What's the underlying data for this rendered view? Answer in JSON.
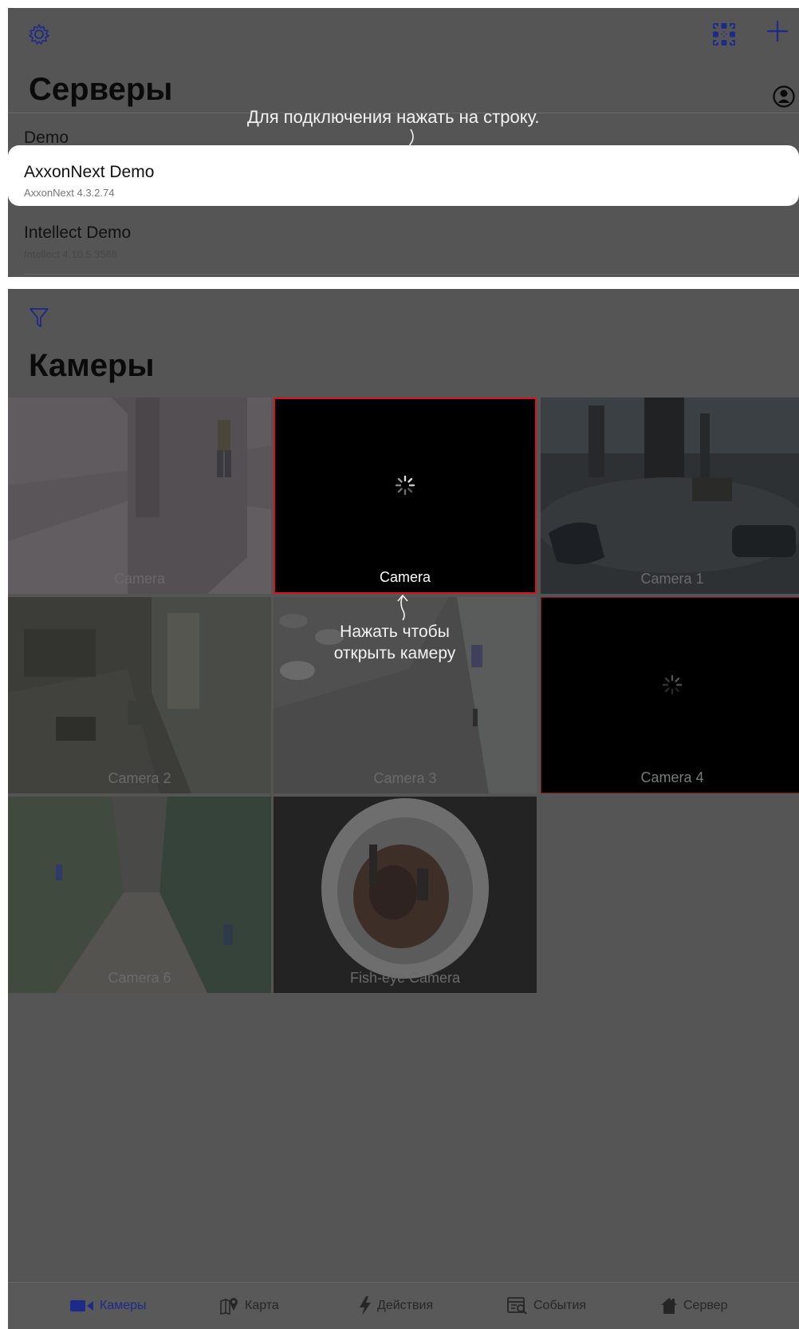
{
  "servers": {
    "title": "Серверы",
    "group_label": "Demo",
    "hint": "Для подключения нажать на строку.",
    "rows": [
      {
        "name": "AxxonNext Demo",
        "version": "AxxonNext 4.3.2.74",
        "highlighted": true
      },
      {
        "name": "Intellect Demo",
        "version": "Intellect 4.10.5.3588",
        "highlighted": false
      }
    ],
    "icons": {
      "settings": "gear-icon",
      "dialpad": "dialpad-icon",
      "add": "plus-icon",
      "account": "account-icon"
    }
  },
  "cameras": {
    "title": "Камеры",
    "hint_line1": "Нажать чтобы",
    "hint_line2": "открыть камеру",
    "tiles": [
      {
        "label": "Camera",
        "state": "video"
      },
      {
        "label": "Camera",
        "state": "loading"
      },
      {
        "label": "Camera 1",
        "state": "video"
      },
      {
        "label": "Camera 2",
        "state": "video"
      },
      {
        "label": "Camera 3",
        "state": "video"
      },
      {
        "label": "Camera 4",
        "state": "loading"
      },
      {
        "label": "Camera 6",
        "state": "video"
      },
      {
        "label": "Fish-eye Camera",
        "state": "video"
      }
    ],
    "icons": {
      "filter": "filter-icon",
      "loading": "spinner-icon"
    }
  },
  "tabbar": {
    "tabs": [
      {
        "label": "Камеры",
        "icon": "video-camera-icon",
        "active": true
      },
      {
        "label": "Карта",
        "icon": "map-icon",
        "active": false
      },
      {
        "label": "Действия",
        "icon": "lightning-icon",
        "active": false
      },
      {
        "label": "События",
        "icon": "events-icon",
        "active": false
      },
      {
        "label": "Сервер",
        "icon": "home-icon",
        "active": false
      }
    ]
  },
  "colors": {
    "overlay": "#555555",
    "accent": "#1c2a8a",
    "selection": "#d8141a",
    "hint_text": "#f2f2f2"
  }
}
